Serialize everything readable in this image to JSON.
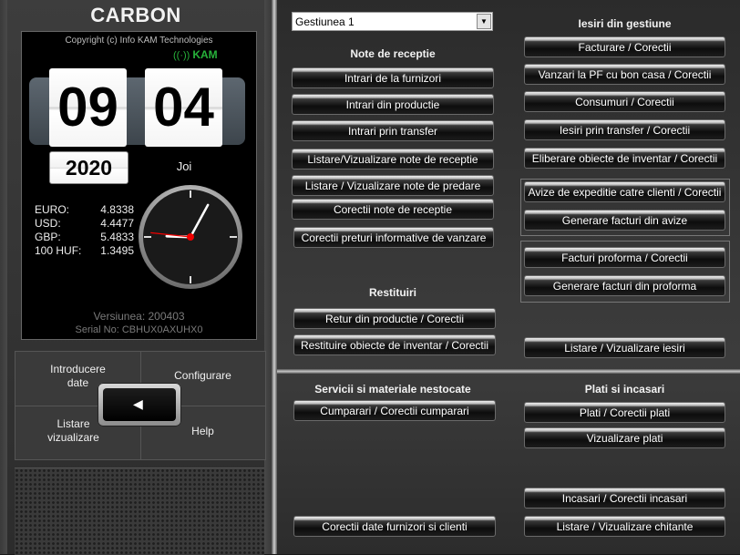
{
  "app": {
    "title": "CARBON"
  },
  "info": {
    "copyright": "Copyright (c) Info KAM Technologies",
    "brand": "KAM",
    "brand_wave": "((·))",
    "hour": "09",
    "minute": "04",
    "year": "2020",
    "day": "Joi",
    "version": "Versiunea: 200403",
    "serial": "Serial No: CBHUX0AXUHX0"
  },
  "rates": [
    {
      "name": "EURO:",
      "value": "4.8338"
    },
    {
      "name": "USD:",
      "value": "4.4477"
    },
    {
      "name": "GBP:",
      "value": "5.4833"
    },
    {
      "name": "100 HUF:",
      "value": "1.3495"
    }
  ],
  "clock": {
    "hour": 9,
    "minute": 4,
    "second": 46
  },
  "nav": {
    "introducere": "Introducere\ndate",
    "configurare": "Configurare",
    "listare": "Listare\nvizualizare",
    "help": "Help",
    "back_glyph": "◀"
  },
  "gestiune": {
    "selected": "Gestiunea 1",
    "arrow": "▼"
  },
  "sections": {
    "note_receptie": "Note de receptie",
    "iesiri": "Iesiri din gestiune",
    "restituiri": "Restituiri",
    "servicii": "Servicii si materiale nestocate",
    "plati": "Plati si incasari"
  },
  "buttons": {
    "intrari_furnizori": "Intrari de la furnizori",
    "intrari_productie": "Intrari din productie",
    "intrari_transfer": "Intrari prin transfer",
    "listare_note_receptie": "Listare/Vizualizare note de receptie",
    "listare_note_predare": "Listare / Vizualizare note de predare",
    "corectii_note_receptie": "Corectii note de receptie",
    "corectii_preturi": "Corectii preturi informative de vanzare",
    "facturare": "Facturare / Corectii",
    "vanzari_pf": "Vanzari la PF cu bon casa / Corectii",
    "consumuri": "Consumuri / Corectii",
    "iesiri_transfer": "Iesiri prin transfer / Corectii",
    "eliberare_inventar": "Eliberare obiecte de inventar / Corectii",
    "avize_expeditie": "Avize de expeditie catre clienti / Corectii",
    "generare_facturi_avize": "Generare facturi din avize",
    "facturi_proforma": "Facturi proforma / Corectii",
    "generare_facturi_proforma": "Generare facturi din proforma",
    "retur_productie": "Retur din productie / Corectii",
    "restituire_inventar": "Restituire obiecte de inventar / Corectii",
    "listare_iesiri": "Listare / Vizualizare iesiri",
    "cumparari": "Cumparari / Corectii cumparari",
    "corectii_furnizori": "Corectii date furnizori si clienti",
    "plati_corectii": "Plati / Corectii plati",
    "vizualizare_plati": "Vizualizare plati",
    "incasari": "Incasari / Corectii incasari",
    "listare_chitante": "Listare / Vizualizare chitante"
  }
}
